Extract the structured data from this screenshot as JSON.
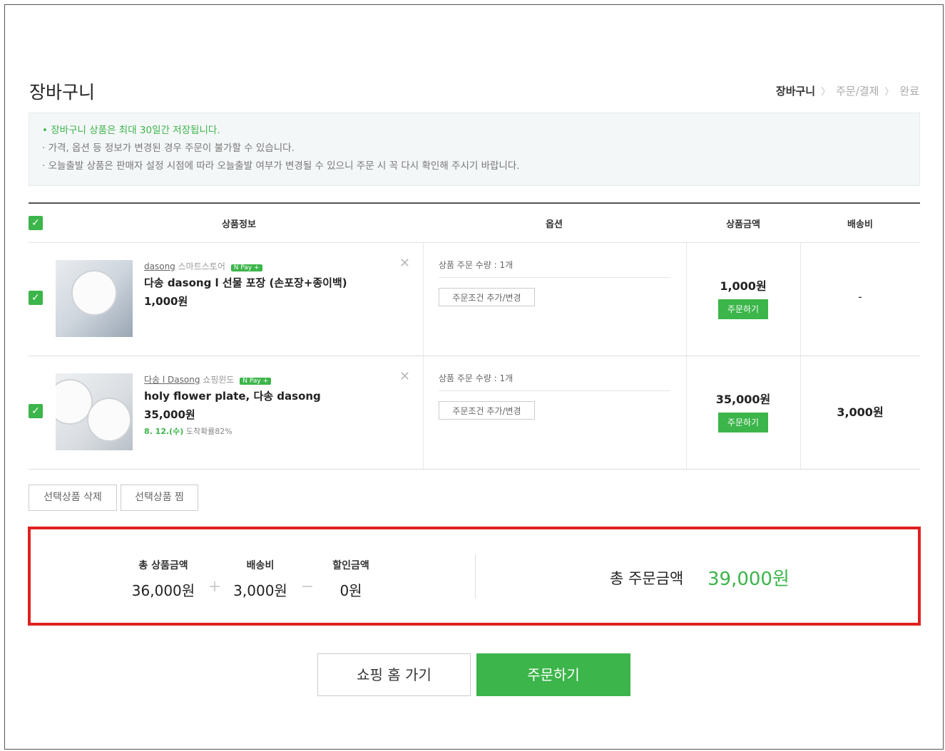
{
  "page": {
    "title": "장바구니"
  },
  "breadcrumb": {
    "current": "장바구니",
    "step2": "주문/결제",
    "step3": "완료",
    "separator": "〉"
  },
  "notice": {
    "lines": [
      "• 장바구니 상품은 최대 30일간 저장됩니다.",
      "· 가격, 옵션 등 정보가 변경된 경우 주문이 불가할 수 있습니다.",
      "· 오늘출발 상품은 판매자 설정 시점에 따라 오늘출발 여부가 변경될 수 있으니 주문 시 꼭 다시 확인해 주시기 바랍니다."
    ]
  },
  "table": {
    "headers": {
      "product_info": "상품정보",
      "option": "옵션",
      "amount": "상품금액",
      "shipping": "배송비"
    }
  },
  "items": [
    {
      "seller_name": "dasong",
      "seller_type": "스마트스토어",
      "npay": "N Pay +",
      "name": "다송 dasong l 선물 포장 (손포장+종이백)",
      "price": "1,000원",
      "delivery_date": "",
      "delivery_rate": "",
      "option_qty": "상품 주문 수량 : 1개",
      "option_button": "주문조건 추가/변경",
      "amount": "1,000원",
      "order_button": "주문하기",
      "shipping": "-"
    },
    {
      "seller_name": "다송 l Dasong",
      "seller_type": "쇼핑윈도",
      "npay": "N Pay +",
      "name": "holy flower plate, 다송 dasong",
      "price": "35,000원",
      "delivery_date": "8. 12.(수)",
      "delivery_rate": " 도착확률82%",
      "option_qty": "상품 주문 수량 : 1개",
      "option_button": "주문조건 추가/변경",
      "amount": "35,000원",
      "order_button": "주문하기",
      "shipping": "3,000원"
    }
  ],
  "actions": {
    "delete_selected": "선택상품 삭제",
    "wish_selected": "선택상품 찜"
  },
  "summary": {
    "product_total_label": "총 상품금액",
    "product_total": "36,000원",
    "plus": "+",
    "shipping_label": "배송비",
    "shipping": "3,000원",
    "minus": "−",
    "discount_label": "할인금액",
    "discount": "0원",
    "order_total_label": "총 주문금액",
    "order_total": "39,000원"
  },
  "buttons": {
    "go_home": "쇼핑 홈 가기",
    "order": "주문하기"
  },
  "colors": {
    "accent": "#3cb54a",
    "highlight_border": "#e02020"
  }
}
